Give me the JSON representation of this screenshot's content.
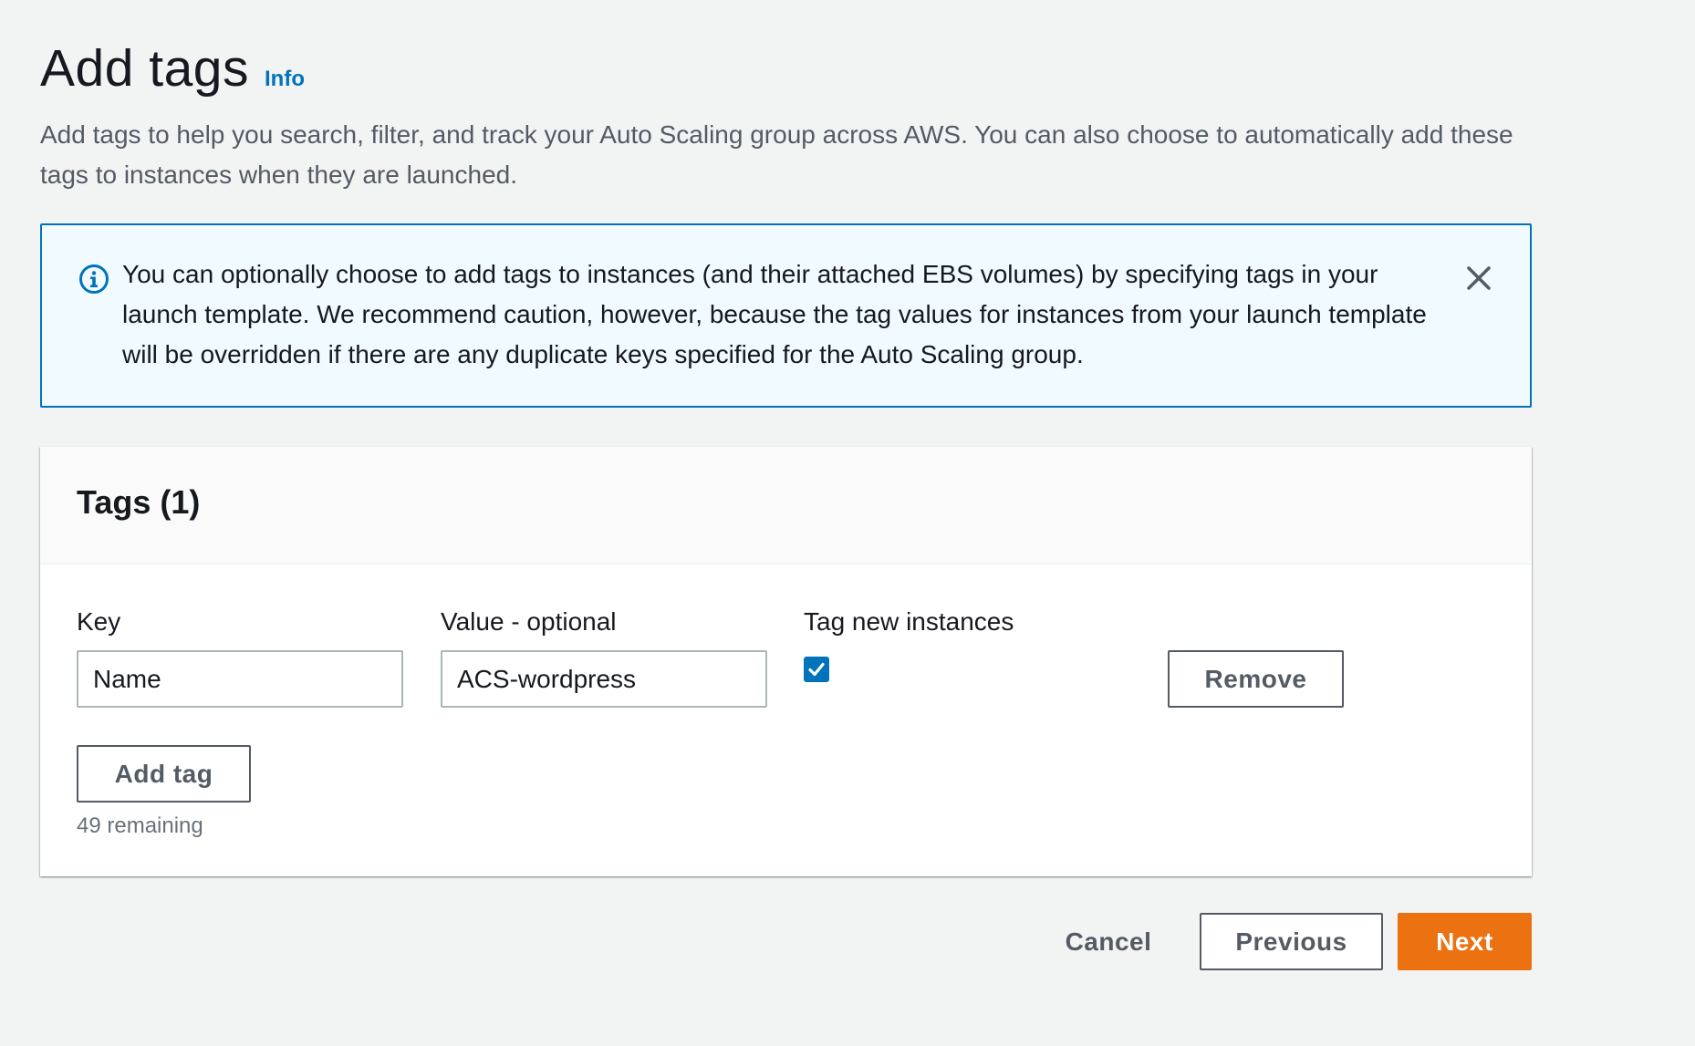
{
  "header": {
    "title": "Add tags",
    "info_link": "Info",
    "description": "Add tags to help you search, filter, and track your Auto Scaling group across AWS. You can also choose to automatically add these tags to instances when they are launched."
  },
  "alert": {
    "message": "You can optionally choose to add tags to instances (and their attached EBS volumes) by specifying tags in your launch template. We recommend caution, however, because the tag values for instances from your launch template will be overridden if there are any duplicate keys specified for the Auto Scaling group.",
    "icon": "info-circle-icon",
    "dismiss_icon": "close-icon"
  },
  "tags": {
    "title": "Tags (1)",
    "columns": {
      "key": "Key",
      "value": "Value - optional",
      "tag_new_instances": "Tag new instances"
    },
    "rows": [
      {
        "key": "Name",
        "value": "ACS-wordpress",
        "tag_new_instances": true,
        "remove_label": "Remove"
      }
    ],
    "add_tag_label": "Add tag",
    "remaining": "49 remaining"
  },
  "footer": {
    "cancel_label": "Cancel",
    "previous_label": "Previous",
    "next_label": "Next"
  },
  "colors": {
    "accent": "#0073bb",
    "primary_button": "#ec7211",
    "background": "#f2f3f3"
  }
}
